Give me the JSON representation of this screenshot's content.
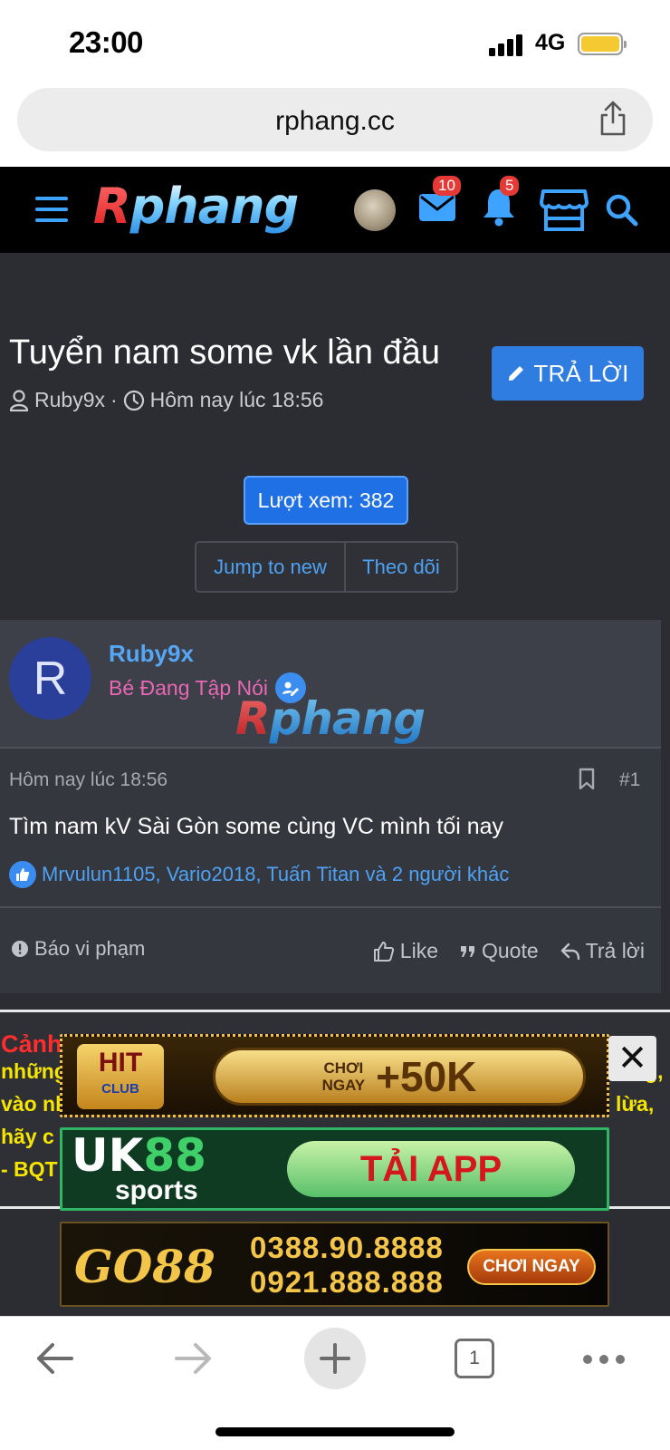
{
  "status_bar": {
    "time": "23:00",
    "network": "4G"
  },
  "browser": {
    "url": "rphang.cc",
    "tab_count": "1"
  },
  "site": {
    "logo_r": "R",
    "logo_rest": "phang",
    "messages_badge": "10",
    "alerts_badge": "5"
  },
  "thread": {
    "title": "Tuyển nam some vk lần đầu",
    "author": "Ruby9x",
    "separator": "·",
    "date": "Hôm nay lúc 18:56",
    "reply_label": "TRẢ LỜI",
    "views_label": "Lượt xem: 382",
    "jump_label": "Jump to new",
    "follow_label": "Theo dõi"
  },
  "post": {
    "avatar_letter": "R",
    "username": "Ruby9x",
    "user_title": "Bé Đang Tập Nói",
    "date": "Hôm nay lúc 18:56",
    "number": "#1",
    "body": "Tìm nam kV Sài Gòn some cùng VC mình tối nay",
    "reactions": "Mrvulun1105, Vario2018, Tuấn Titan và 2 người khác",
    "report_label": "Báo vi phạm",
    "like_label": "Like",
    "quote_label": "Quote",
    "reply_label": "Trả lời"
  },
  "notice": {
    "title": "Cảnh",
    "line1_left": "những",
    "line1_right": "ng,",
    "line2_left": "vào nh",
    "line2_right": "lừa,",
    "line3_left": "hãy c",
    "line4_left": "- BQT"
  },
  "ads": {
    "ad1_logo": "HIT",
    "ad1_sub": "CLUB",
    "ad1_small1": "CHƠI",
    "ad1_small2": "NGAY",
    "ad1_big": "+50K",
    "ad2_uk": "UK",
    "ad2_num": "88",
    "ad2_sports": "sports",
    "ad2_cta": "TẢI APP",
    "ad3_logo": "GO88",
    "ad3_phone1": "0388.90.8888",
    "ad3_phone2": "0921.888.888",
    "ad3_cta": "CHƠI NGAY",
    "close_label": "✕"
  },
  "colors": {
    "accent": "#2f7de1",
    "link": "#4ea1f3",
    "page_bg": "#2b2d33",
    "user_title": "#e868b5",
    "warning_red": "#ff2d2d",
    "warning_yellow": "#f5e500"
  },
  "icons": {
    "menu": "menu-icon",
    "inbox": "envelope-icon",
    "alerts": "bell-icon",
    "store": "store-icon",
    "search": "search-icon",
    "share": "share-icon",
    "user": "user-icon",
    "clock": "clock-icon",
    "pencil": "pencil-icon",
    "bookmark": "bookmark-icon",
    "like": "thumbs-up-icon",
    "quote": "quote-icon",
    "reply": "reply-arrow-icon",
    "report": "alert-circle-icon"
  }
}
